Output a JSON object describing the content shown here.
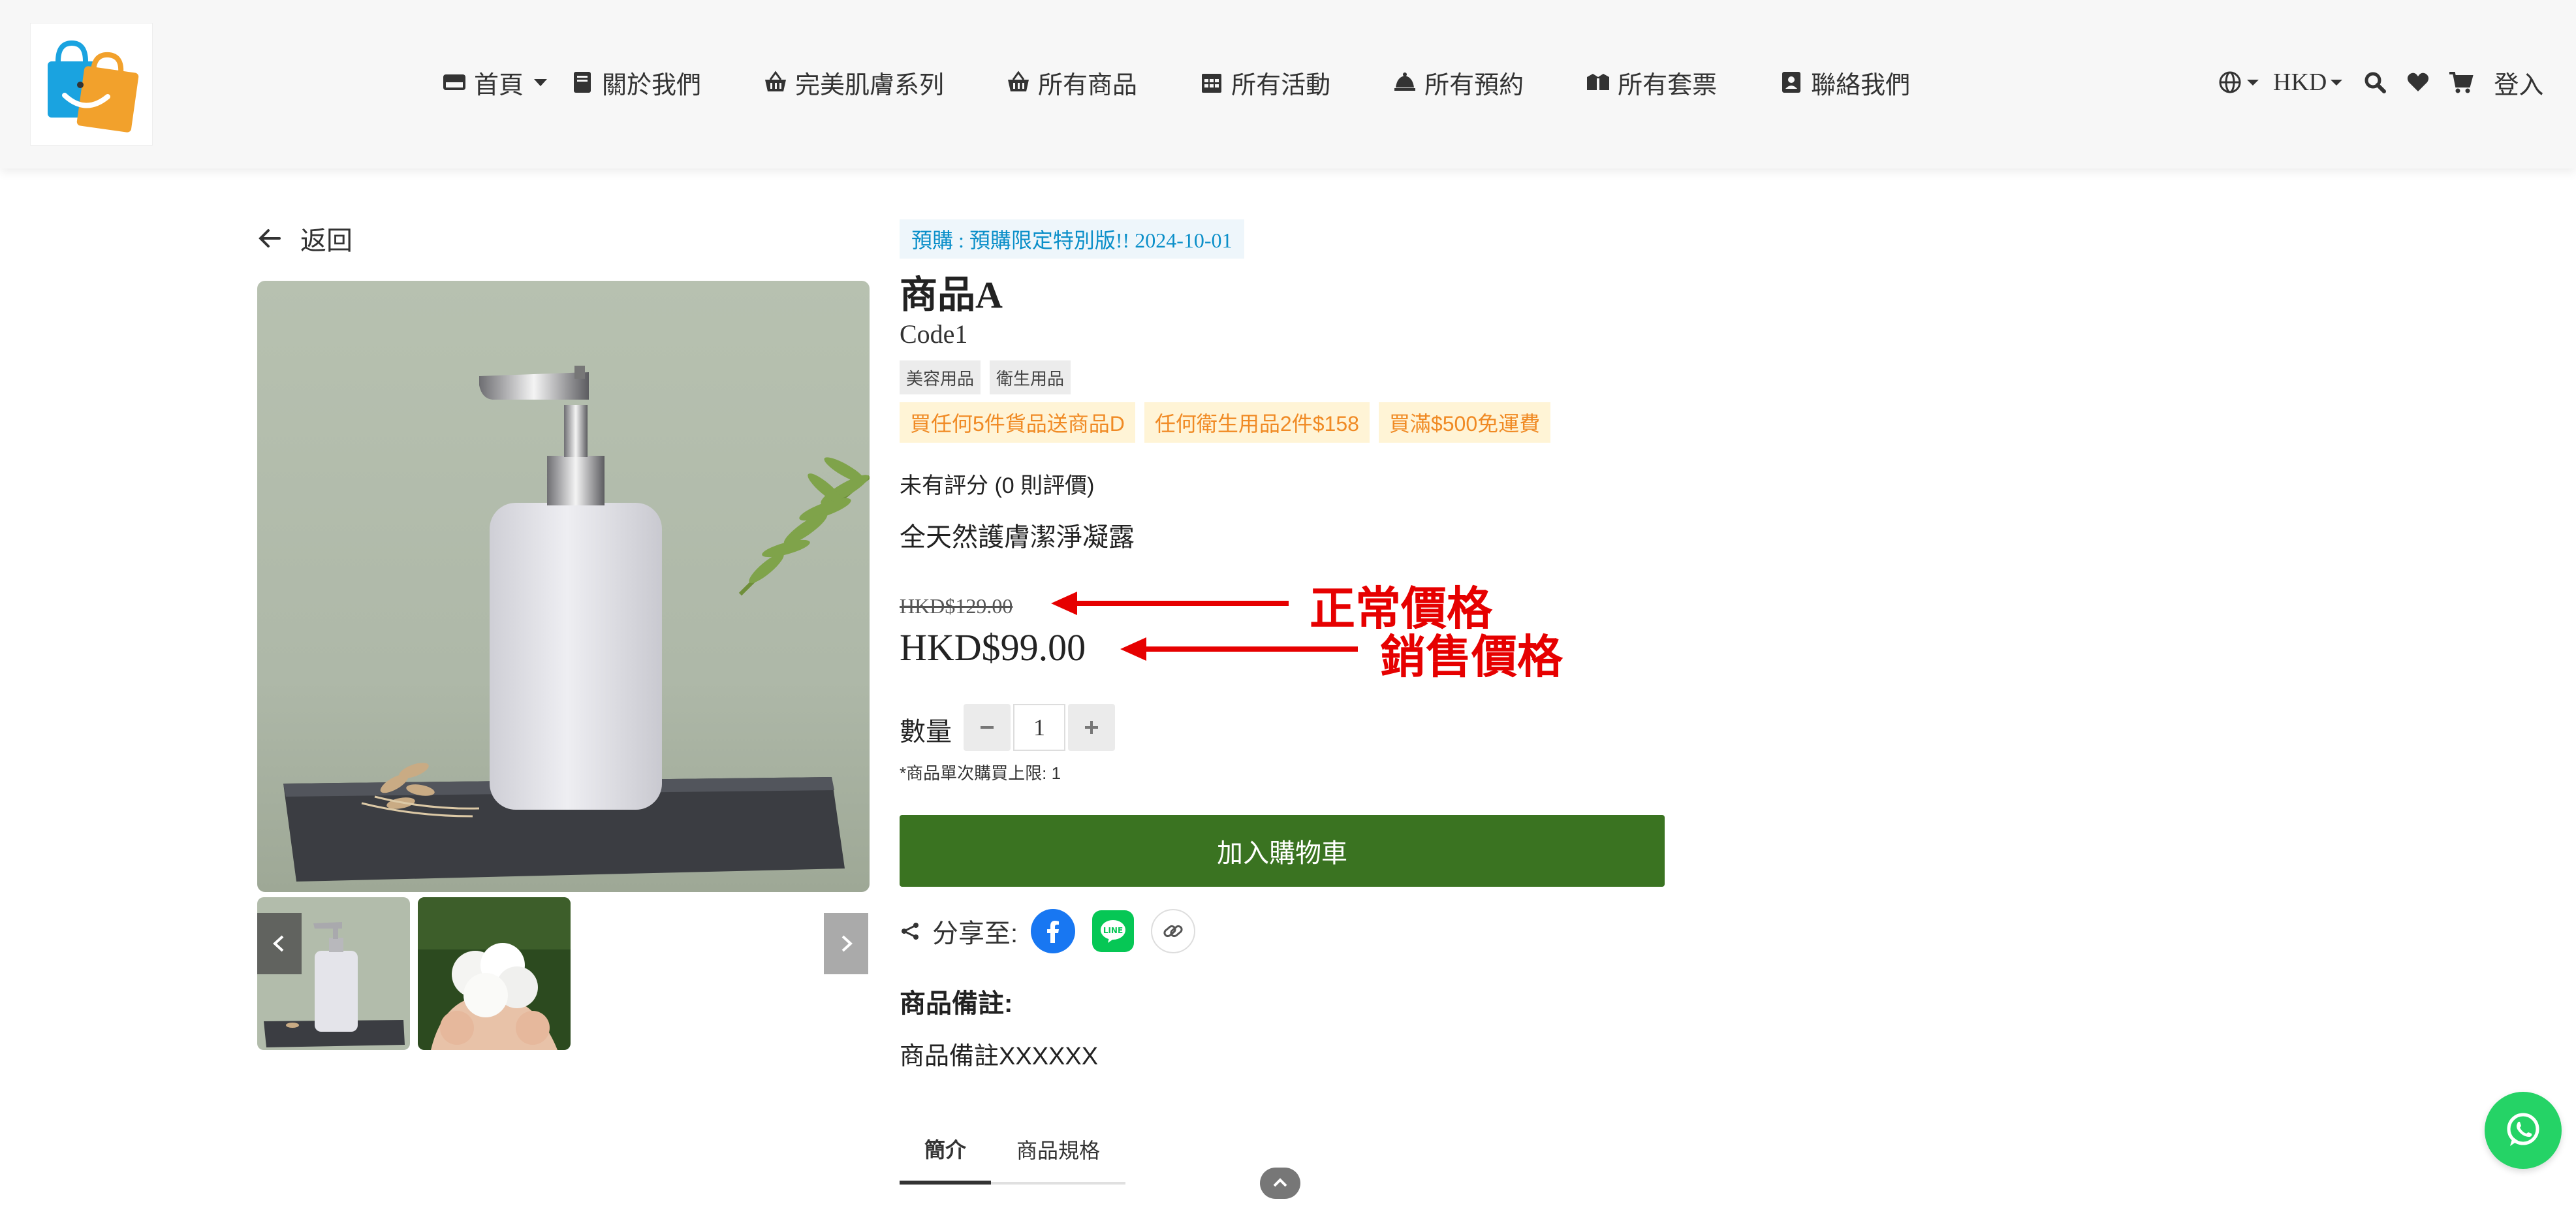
{
  "header": {
    "nav": [
      {
        "label": "首頁",
        "icon": "credit-card-icon",
        "has_dropdown": true
      },
      {
        "label": "關於我們",
        "icon": "book-icon"
      },
      {
        "label": "完美肌膚系列",
        "icon": "basket-icon"
      },
      {
        "label": "所有商品",
        "icon": "basket-icon"
      },
      {
        "label": "所有活動",
        "icon": "calendar-icon"
      },
      {
        "label": "所有預約",
        "icon": "bell-icon"
      },
      {
        "label": "所有套票",
        "icon": "ticket-icon"
      },
      {
        "label": "聯絡我們",
        "icon": "contact-card-icon"
      }
    ],
    "currency": "HKD",
    "login_label": "登入"
  },
  "back_label": "返回",
  "product": {
    "preorder_badge": "預購 : 預購限定特別版!! 2024-10-01",
    "title": "商品A",
    "code": "Code1",
    "tags": [
      "美容用品",
      "衛生用品"
    ],
    "promotions": [
      "買任何5件貨品送商品D",
      "任何衛生用品2件$158",
      "買滿$500免運費"
    ],
    "rating_text": "未有評分 (0 則評價)",
    "description": "全天然護膚潔淨凝露",
    "original_price": "HKD$129.00",
    "sale_price": "HKD$99.00",
    "quantity_label": "數量",
    "quantity_value": "1",
    "quantity_limit": "*商品單次購買上限: 1",
    "add_to_cart_label": "加入購物車",
    "share_label": "分享至:",
    "notes_title": "商品備註:",
    "notes_body": "商品備註XXXXXX",
    "tabs": [
      "簡介",
      "商品規格"
    ]
  },
  "annotations": {
    "regular_price": "正常價格",
    "sale_price": "銷售價格"
  },
  "colors": {
    "cart_button": "#3a7321",
    "annotation": "#e60000",
    "preorder_text": "#0b8fc9",
    "promo_text": "#f08a24",
    "whatsapp": "#25d366",
    "facebook": "#1877f2",
    "line": "#06c755"
  }
}
